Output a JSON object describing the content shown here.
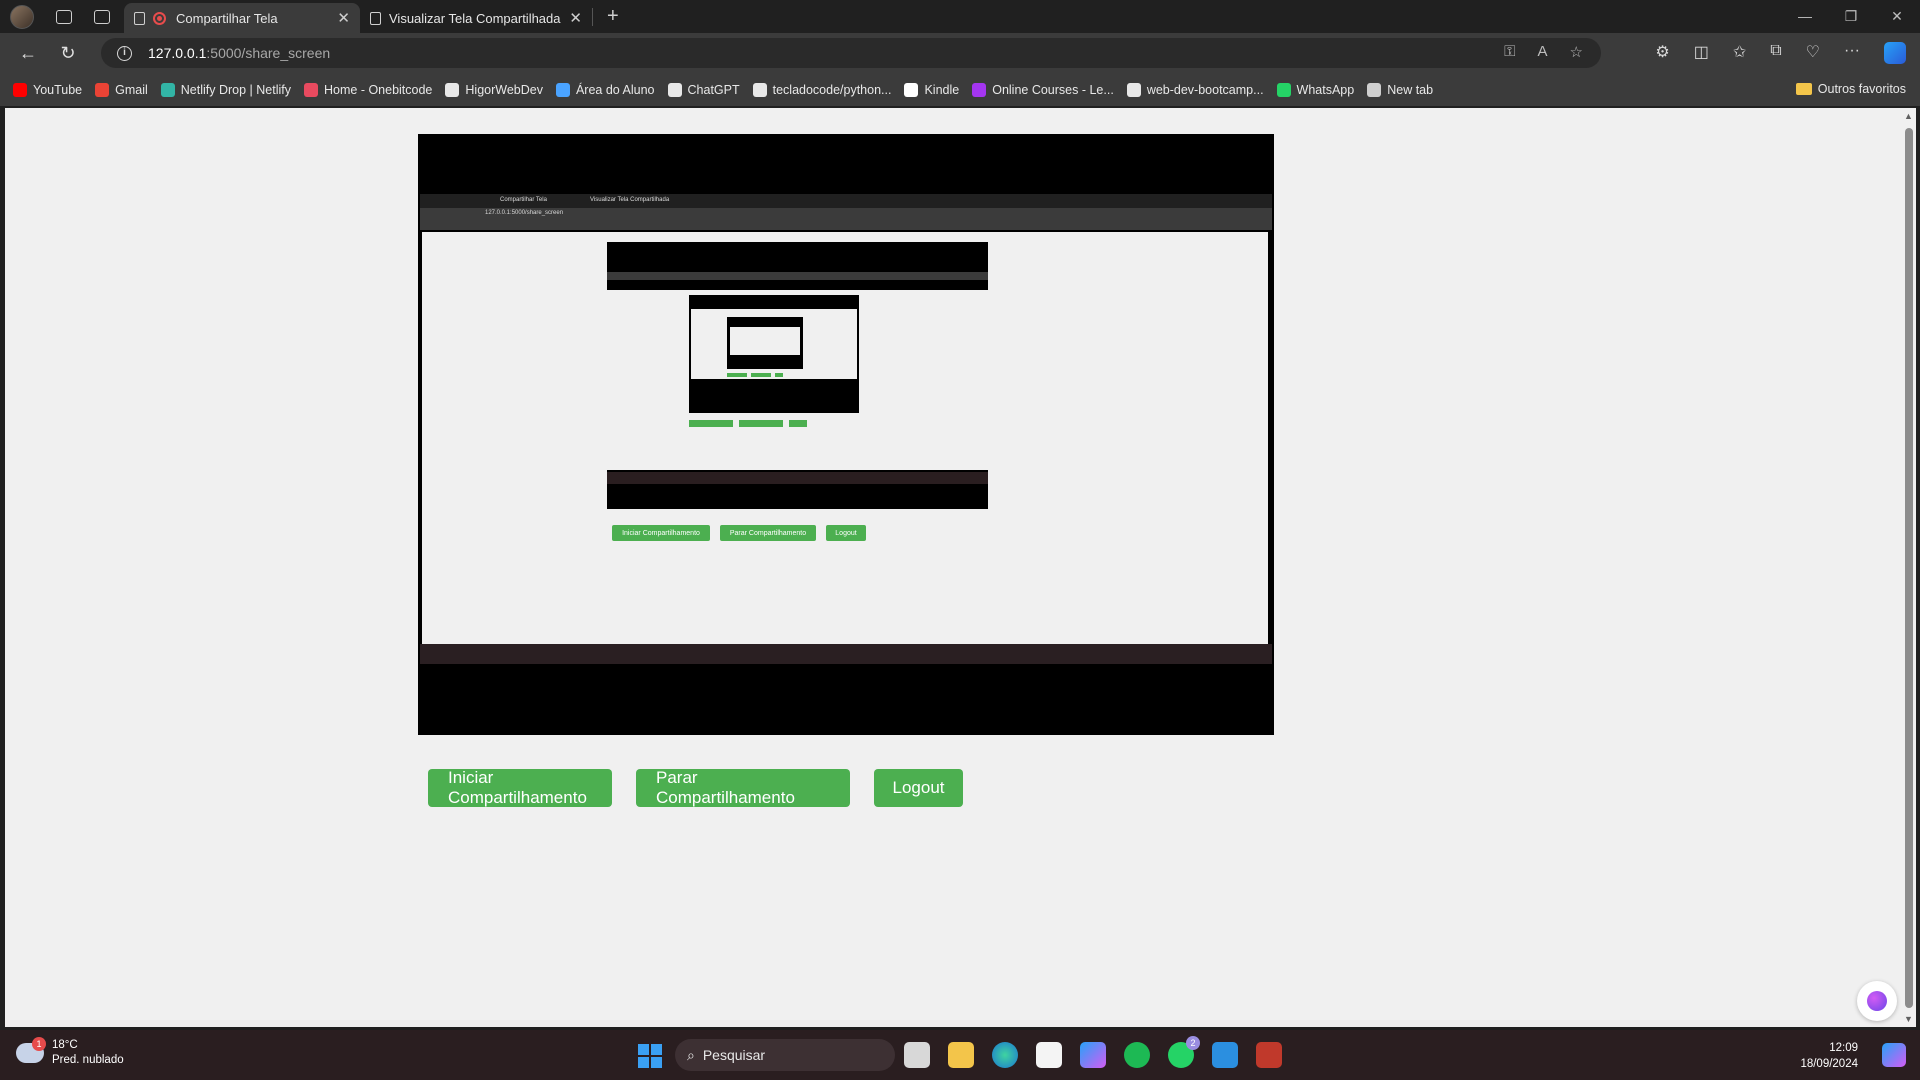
{
  "browser": {
    "tabs": [
      {
        "title": "Compartilhar Tela",
        "active": true
      },
      {
        "title": "Visualizar Tela Compartilhada",
        "active": false
      }
    ],
    "address": {
      "host": "127.0.0.1",
      "path": ":5000/share_screen"
    },
    "bookmarks": [
      {
        "label": "YouTube",
        "icon": "youtube-icon",
        "color": "#ff0000"
      },
      {
        "label": "Gmail",
        "icon": "gmail-icon",
        "color": "#ea4335"
      },
      {
        "label": "Netlify Drop | Netlify",
        "icon": "netlify-icon",
        "color": "#32b5a6"
      },
      {
        "label": "Home - Onebitcode",
        "icon": "onebitcode-icon",
        "color": "#e84a5f"
      },
      {
        "label": "HigorWebDev",
        "icon": "github-icon",
        "color": "#e8e8e8"
      },
      {
        "label": "Área do Aluno",
        "icon": "aluno-icon",
        "color": "#4aa3ff"
      },
      {
        "label": "ChatGPT",
        "icon": "chatgpt-icon",
        "color": "#e8e8e8"
      },
      {
        "label": "tecladocode/python...",
        "icon": "github-icon",
        "color": "#e8e8e8"
      },
      {
        "label": "Kindle",
        "icon": "kindle-icon",
        "color": "#ffffff"
      },
      {
        "label": "Online Courses - Le...",
        "icon": "udemy-icon",
        "color": "#a435f0"
      },
      {
        "label": "web-dev-bootcamp...",
        "icon": "github-icon",
        "color": "#e8e8e8"
      },
      {
        "label": "WhatsApp",
        "icon": "whatsapp-icon",
        "color": "#25d366"
      },
      {
        "label": "New tab",
        "icon": "newtab-icon",
        "color": "#cfcfcf"
      }
    ],
    "other_favorites": "Outros favoritos"
  },
  "page": {
    "buttons": {
      "start": "Iniciar Compartilhamento",
      "stop": "Parar Compartilhamento",
      "logout": "Logout"
    },
    "accent": "#4caf50"
  },
  "taskbar": {
    "weather": {
      "temp": "18°C",
      "desc": "Pred. nublado",
      "badge": "1"
    },
    "search_placeholder": "Pesquisar",
    "whatsapp_badge": "2",
    "time": "12:09",
    "date": "18/09/2024"
  }
}
